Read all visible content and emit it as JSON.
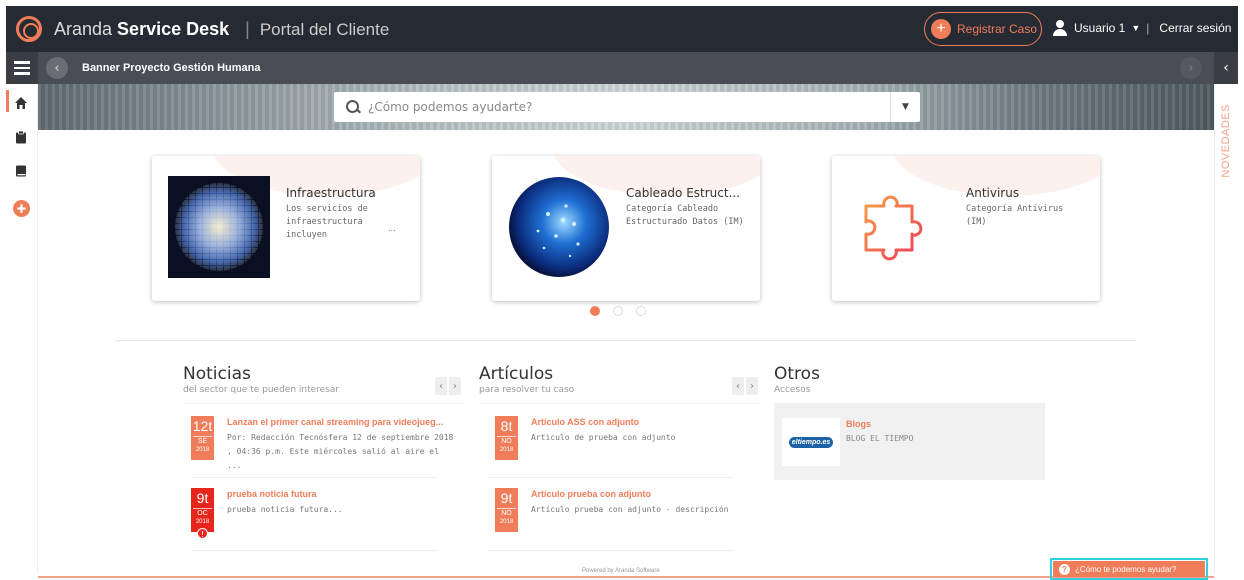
{
  "header": {
    "brand_light": "Aranda",
    "brand_bold": "Service Desk",
    "separator": "|",
    "portal": "Portal del Cliente",
    "register_label": "Registrar Caso",
    "user_label": "Usuario 1",
    "logout_label": "Cerrar sesión"
  },
  "subbar": {
    "title": "Banner Proyecto Gestión Humana"
  },
  "search": {
    "placeholder": "¿Cómo podemos ayudarte?"
  },
  "side_panel": {
    "label": "NOVEDADES"
  },
  "sidebar": {
    "items": [
      "home-icon",
      "clipboard-icon",
      "book-icon",
      "add-circle-icon"
    ]
  },
  "carousel": {
    "cards": [
      {
        "name": "Infraestructura",
        "desc": "Los servicios de infraestructura incluyen",
        "more": "..."
      },
      {
        "name": "Cableado Estruct...",
        "desc": "Categoría Cableado Estructurado Datos (IM)",
        "more": ""
      },
      {
        "name": "Antivirus",
        "desc": "Categoría Antivirus (IM)",
        "more": ""
      }
    ],
    "active_page": 1,
    "page_count": 3
  },
  "noticias": {
    "title": "Noticias",
    "subtitle": "del sector que te pueden interesar",
    "items": [
      {
        "day": "12t",
        "month": "SE",
        "year": "2018",
        "title": "Lanzan el primer canal streaming para videojueg...",
        "body": "Por: Redacción Tecnósfera 12 de septiembre 2018 , 04:36 p.m. Este miércoles salió al aire el ..."
      },
      {
        "day": "9t",
        "month": "OC",
        "year": "2018",
        "title": "prueba noticia futura",
        "body": "prueba noticia futura..."
      }
    ]
  },
  "articulos": {
    "title": "Artículos",
    "subtitle": "para resolver tu caso",
    "items": [
      {
        "day": "8t",
        "month": "NO",
        "year": "2018",
        "title": "Articulo ASS con adjunto",
        "body": "Articulo de prueba con adjunto"
      },
      {
        "day": "9t",
        "month": "NO",
        "year": "2018",
        "title": "Articulo prueba con adjunto",
        "body": "Artículo prueba con adjunto - descripción"
      }
    ]
  },
  "otros": {
    "title": "Otros",
    "subtitle": "Accesos",
    "blog_title": "Blogs",
    "blog_desc": "BLOG EL TIEMPO",
    "blog_logo_text": "eltiempo.es"
  },
  "footer": {
    "powered": "Powered by Aranda Software",
    "help_label": "¿Cómo te podemos ayudar?"
  },
  "colors": {
    "accent": "#f07d5a",
    "topbar": "#262a33",
    "subbar": "#4a4d54",
    "alert": "#e8251c",
    "help_outline": "#2fd0e0"
  }
}
